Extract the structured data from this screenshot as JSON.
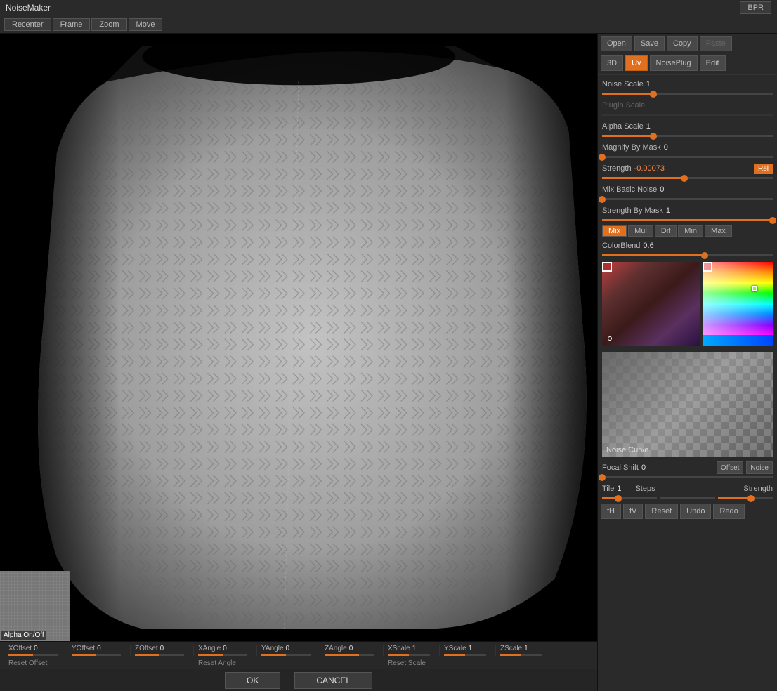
{
  "titlebar": {
    "title": "NoiseMaker"
  },
  "bpr": {
    "label": "BPR"
  },
  "nav": {
    "recenter": "Recenter",
    "frame": "Frame",
    "zoom": "Zoom",
    "move": "Move"
  },
  "right_panel_top": {
    "open": "Open",
    "save": "Save",
    "copy": "Copy",
    "paste": "Paste"
  },
  "mode_buttons": {
    "btn3d": "3D",
    "uv": "Uv",
    "noiseplug": "NoisePlug",
    "edit": "Edit"
  },
  "params": {
    "noise_scale": {
      "label": "Noise Scale",
      "value": "1"
    },
    "plugin_scale": {
      "label": "Plugin Scale",
      "value": ""
    },
    "alpha_scale": {
      "label": "Alpha Scale",
      "value": "1"
    },
    "magnify_by_mask": {
      "label": "Magnify By Mask",
      "value": "0"
    },
    "strength": {
      "label": "Strength",
      "value": "-0.00073"
    },
    "mix_basic_noise": {
      "label": "Mix Basic Noise",
      "value": "0"
    },
    "strength_by_mask": {
      "label": "Strength By Mask",
      "value": "1"
    },
    "color_blend": {
      "label": "ColorBlend",
      "value": "0.6"
    },
    "focal_shift": {
      "label": "Focal Shift",
      "value": "0"
    },
    "offset": {
      "label": "Offset"
    },
    "noise_label": {
      "label": "Noise"
    },
    "tile": {
      "label": "Tile",
      "value": "1"
    },
    "steps": {
      "label": "Steps"
    },
    "strength2": {
      "label": "Strength"
    }
  },
  "blend_modes": {
    "mix": "Mix",
    "mul": "Mul",
    "dif": "Dif",
    "min": "Min",
    "max": "Max"
  },
  "noise_curve": {
    "label": "Noise Curve"
  },
  "action_buttons": {
    "fh": "fH",
    "fv": "fV",
    "reset": "Reset",
    "undo": "Undo",
    "redo": "Redo"
  },
  "alpha_preview": {
    "label": "Alpha On/Off"
  },
  "bottom_params": [
    {
      "label": "XOffset",
      "value": "0"
    },
    {
      "label": "YOffset",
      "value": "0"
    },
    {
      "label": "ZOffset",
      "value": "0"
    },
    {
      "label": "XAngle",
      "value": "0"
    },
    {
      "label": "YAngle",
      "value": "0"
    },
    {
      "label": "ZAngle",
      "value": "0"
    },
    {
      "label": "XScale",
      "value": "1"
    },
    {
      "label": "YScale",
      "value": "1"
    },
    {
      "label": "ZScale",
      "value": "1"
    }
  ],
  "reset_buttons": {
    "reset_offset": "Reset Offset",
    "reset_angle": "Reset Angle",
    "reset_scale": "Reset Scale"
  },
  "footer": {
    "ok": "OK",
    "cancel": "CANCEL"
  }
}
